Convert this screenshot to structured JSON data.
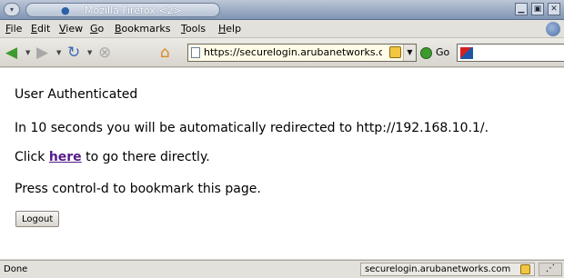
{
  "window": {
    "title": "Mozilla Firefox <2>",
    "buttons": {
      "minimize": "▁",
      "maximize": "▣",
      "close": "✕"
    }
  },
  "menubar": {
    "items": [
      "File",
      "Edit",
      "View",
      "Go",
      "Bookmarks",
      "Tools",
      "Help"
    ]
  },
  "toolbar": {
    "url": "https://securelogin.arubanetworks.com",
    "go_label": "Go",
    "icons": [
      "back-arrow-icon",
      "forward-arrow-icon",
      "reload-icon",
      "stop-icon",
      "home-icon",
      "page-icon",
      "lock-icon",
      "go-icon",
      "search-engine-icon"
    ],
    "colors": {
      "back": "#3e9a2f",
      "forward": "#9a9a9a",
      "reload": "#3b6bb8",
      "stop": "#9a9a9a",
      "home": "#d88a1e"
    }
  },
  "content": {
    "heading": "User Authenticated",
    "redirect_text": "In 10 seconds you will be automatically redirected to http://192.168.10.1/.",
    "click_prefix": "Click ",
    "click_link": "here",
    "click_suffix": " to go there directly.",
    "bookmark_text": "Press control-d to bookmark this page.",
    "logout_button": "Logout",
    "link_color": "#551a8b"
  },
  "statusbar": {
    "status": "Done",
    "host": "securelogin.arubanetworks.com"
  }
}
